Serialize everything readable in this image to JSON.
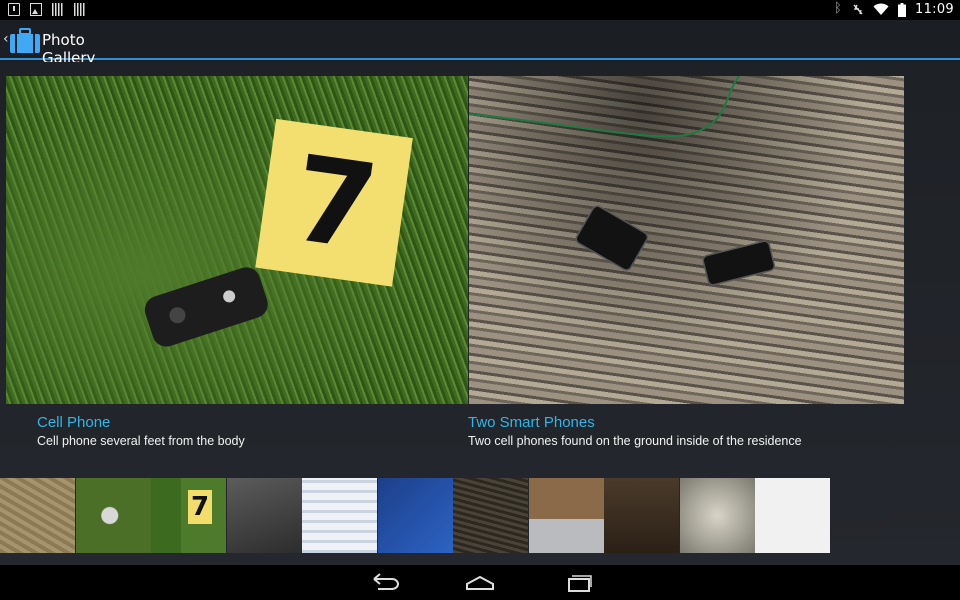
{
  "status_bar": {
    "time": "11:09",
    "left_icons": [
      "download-icon",
      "image-icon",
      "barcode-icon",
      "barcode-icon"
    ],
    "right_icons": [
      "bluetooth-icon",
      "screen-rotation-icon",
      "wifi-icon",
      "battery-icon"
    ]
  },
  "action_bar": {
    "title": "Photo Gallery",
    "up_icon": "chevron-left-icon",
    "app_icon": "briefcase-icon",
    "accent_color": "#33b5e5"
  },
  "gallery": {
    "photos": [
      {
        "title": "Cell Phone",
        "description": "Cell phone several feet from the body",
        "marker": "7"
      },
      {
        "title": "Two Smart Phones",
        "description": "Two cell phones found on the ground inside of the residence"
      }
    ],
    "thumbnail_count": 11,
    "third_thumb_marker": "7"
  },
  "nav_bar": {
    "buttons": [
      "back-icon",
      "home-icon",
      "recent-apps-icon"
    ]
  }
}
